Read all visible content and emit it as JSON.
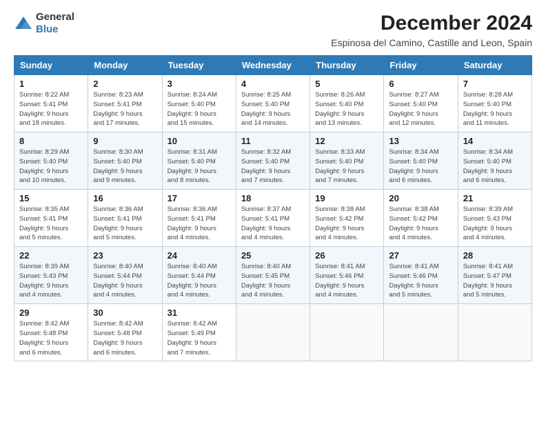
{
  "logo": {
    "general": "General",
    "blue": "Blue"
  },
  "title": "December 2024",
  "subtitle": "Espinosa del Camino, Castille and Leon, Spain",
  "days_header": [
    "Sunday",
    "Monday",
    "Tuesday",
    "Wednesday",
    "Thursday",
    "Friday",
    "Saturday"
  ],
  "weeks": [
    [
      {
        "num": "1",
        "sunrise": "8:22 AM",
        "sunset": "5:41 PM",
        "daylight": "9 hours and 18 minutes."
      },
      {
        "num": "2",
        "sunrise": "8:23 AM",
        "sunset": "5:41 PM",
        "daylight": "9 hours and 17 minutes."
      },
      {
        "num": "3",
        "sunrise": "8:24 AM",
        "sunset": "5:40 PM",
        "daylight": "9 hours and 15 minutes."
      },
      {
        "num": "4",
        "sunrise": "8:25 AM",
        "sunset": "5:40 PM",
        "daylight": "9 hours and 14 minutes."
      },
      {
        "num": "5",
        "sunrise": "8:26 AM",
        "sunset": "5:40 PM",
        "daylight": "9 hours and 13 minutes."
      },
      {
        "num": "6",
        "sunrise": "8:27 AM",
        "sunset": "5:40 PM",
        "daylight": "9 hours and 12 minutes."
      },
      {
        "num": "7",
        "sunrise": "8:28 AM",
        "sunset": "5:40 PM",
        "daylight": "9 hours and 11 minutes."
      }
    ],
    [
      {
        "num": "8",
        "sunrise": "8:29 AM",
        "sunset": "5:40 PM",
        "daylight": "9 hours and 10 minutes."
      },
      {
        "num": "9",
        "sunrise": "8:30 AM",
        "sunset": "5:40 PM",
        "daylight": "9 hours and 9 minutes."
      },
      {
        "num": "10",
        "sunrise": "8:31 AM",
        "sunset": "5:40 PM",
        "daylight": "9 hours and 8 minutes."
      },
      {
        "num": "11",
        "sunrise": "8:32 AM",
        "sunset": "5:40 PM",
        "daylight": "9 hours and 7 minutes."
      },
      {
        "num": "12",
        "sunrise": "8:33 AM",
        "sunset": "5:40 PM",
        "daylight": "9 hours and 7 minutes."
      },
      {
        "num": "13",
        "sunrise": "8:34 AM",
        "sunset": "5:40 PM",
        "daylight": "9 hours and 6 minutes."
      },
      {
        "num": "14",
        "sunrise": "8:34 AM",
        "sunset": "5:40 PM",
        "daylight": "9 hours and 6 minutes."
      }
    ],
    [
      {
        "num": "15",
        "sunrise": "8:35 AM",
        "sunset": "5:41 PM",
        "daylight": "9 hours and 5 minutes."
      },
      {
        "num": "16",
        "sunrise": "8:36 AM",
        "sunset": "5:41 PM",
        "daylight": "9 hours and 5 minutes."
      },
      {
        "num": "17",
        "sunrise": "8:36 AM",
        "sunset": "5:41 PM",
        "daylight": "9 hours and 4 minutes."
      },
      {
        "num": "18",
        "sunrise": "8:37 AM",
        "sunset": "5:41 PM",
        "daylight": "9 hours and 4 minutes."
      },
      {
        "num": "19",
        "sunrise": "8:38 AM",
        "sunset": "5:42 PM",
        "daylight": "9 hours and 4 minutes."
      },
      {
        "num": "20",
        "sunrise": "8:38 AM",
        "sunset": "5:42 PM",
        "daylight": "9 hours and 4 minutes."
      },
      {
        "num": "21",
        "sunrise": "8:39 AM",
        "sunset": "5:43 PM",
        "daylight": "9 hours and 4 minutes."
      }
    ],
    [
      {
        "num": "22",
        "sunrise": "8:39 AM",
        "sunset": "5:43 PM",
        "daylight": "9 hours and 4 minutes."
      },
      {
        "num": "23",
        "sunrise": "8:40 AM",
        "sunset": "5:44 PM",
        "daylight": "9 hours and 4 minutes."
      },
      {
        "num": "24",
        "sunrise": "8:40 AM",
        "sunset": "5:44 PM",
        "daylight": "9 hours and 4 minutes."
      },
      {
        "num": "25",
        "sunrise": "8:40 AM",
        "sunset": "5:45 PM",
        "daylight": "9 hours and 4 minutes."
      },
      {
        "num": "26",
        "sunrise": "8:41 AM",
        "sunset": "5:46 PM",
        "daylight": "9 hours and 4 minutes."
      },
      {
        "num": "27",
        "sunrise": "8:41 AM",
        "sunset": "5:46 PM",
        "daylight": "9 hours and 5 minutes."
      },
      {
        "num": "28",
        "sunrise": "8:41 AM",
        "sunset": "5:47 PM",
        "daylight": "9 hours and 5 minutes."
      }
    ],
    [
      {
        "num": "29",
        "sunrise": "8:42 AM",
        "sunset": "5:48 PM",
        "daylight": "9 hours and 6 minutes."
      },
      {
        "num": "30",
        "sunrise": "8:42 AM",
        "sunset": "5:48 PM",
        "daylight": "9 hours and 6 minutes."
      },
      {
        "num": "31",
        "sunrise": "8:42 AM",
        "sunset": "5:49 PM",
        "daylight": "9 hours and 7 minutes."
      },
      null,
      null,
      null,
      null
    ]
  ],
  "labels": {
    "sunrise": "Sunrise:",
    "sunset": "Sunset:",
    "daylight": "Daylight:"
  }
}
